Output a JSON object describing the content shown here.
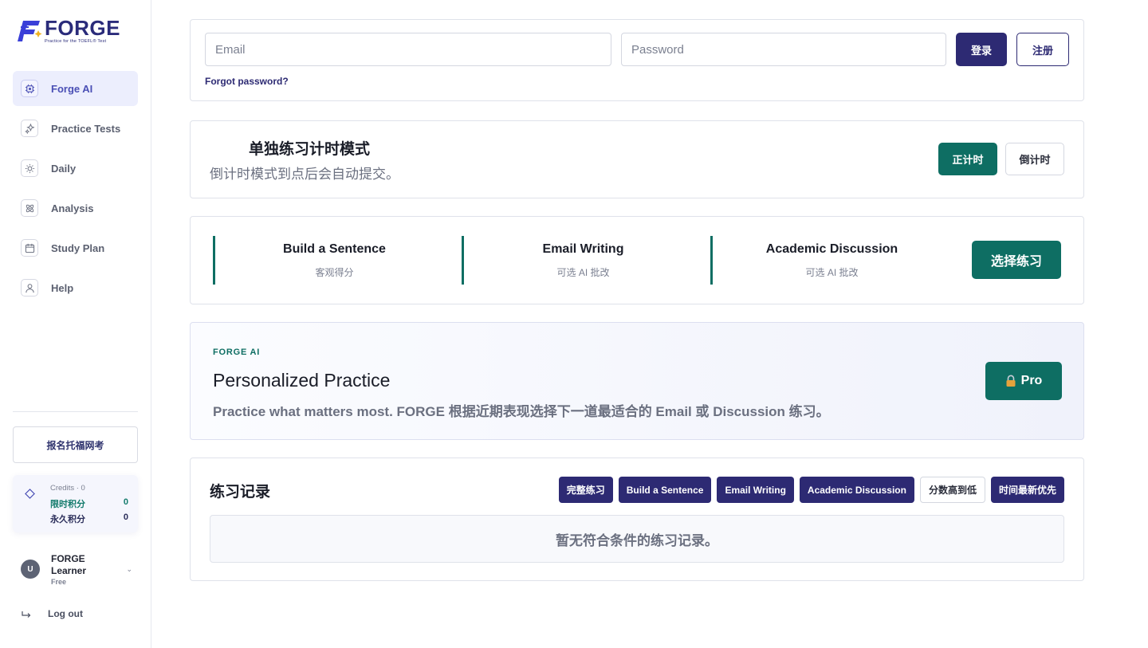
{
  "brand": {
    "name": "FORGE",
    "tagline": "Practice for the TOEFL® Test",
    "accent": "#2d2a73",
    "teal": "#0e6e63"
  },
  "sidebar": {
    "items": [
      {
        "label": "Forge AI",
        "icon": "chip-icon",
        "active": true
      },
      {
        "label": "Practice Tests",
        "icon": "sparkle-icon",
        "active": false
      },
      {
        "label": "Daily",
        "icon": "sun-icon",
        "active": false
      },
      {
        "label": "Analysis",
        "icon": "atom-icon",
        "active": false
      },
      {
        "label": "Study Plan",
        "icon": "calendar-icon",
        "active": false
      },
      {
        "label": "Help",
        "icon": "person-icon",
        "active": false
      }
    ],
    "register_label": "报名托福网考",
    "credits": {
      "title": "Credits · 0",
      "limited_label": "限时积分",
      "limited_value": "0",
      "permanent_label": "永久积分",
      "permanent_value": "0"
    },
    "user": {
      "initial": "U",
      "name": "FORGE Learner",
      "plan": "Free"
    },
    "logout_label": "Log out"
  },
  "login": {
    "email_placeholder": "Email",
    "password_placeholder": "Password",
    "login_label": "登录",
    "signup_label": "注册",
    "forgot_label": "Forgot password?"
  },
  "timer": {
    "title": "单独练习计时模式",
    "description": "倒计时模式到点后会自动提交。",
    "count_up_label": "正计时",
    "count_down_label": "倒计时"
  },
  "task_types": {
    "items": [
      {
        "name": "Build a Sentence",
        "sub": "客观得分"
      },
      {
        "name": "Email Writing",
        "sub": "可选 AI 批改"
      },
      {
        "name": "Academic Discussion",
        "sub": "可选 AI 批改"
      }
    ],
    "choose_label": "选择练习"
  },
  "forge_ai": {
    "kicker": "FORGE AI",
    "title": "Personalized Practice",
    "description": "Practice what matters most. FORGE 根据近期表现选择下一道最适合的 Email 或 Discussion 练习。",
    "pro_label": "Pro"
  },
  "records": {
    "title": "练习记录",
    "filters": [
      {
        "label": "完整练习",
        "style": "dark"
      },
      {
        "label": "Build a Sentence",
        "style": "dark"
      },
      {
        "label": "Email Writing",
        "style": "dark"
      },
      {
        "label": "Academic Discussion",
        "style": "dark"
      },
      {
        "label": "分数高到低",
        "style": "light"
      },
      {
        "label": "时间最新优先",
        "style": "dark"
      }
    ],
    "empty_text": "暂无符合条件的练习记录。"
  }
}
